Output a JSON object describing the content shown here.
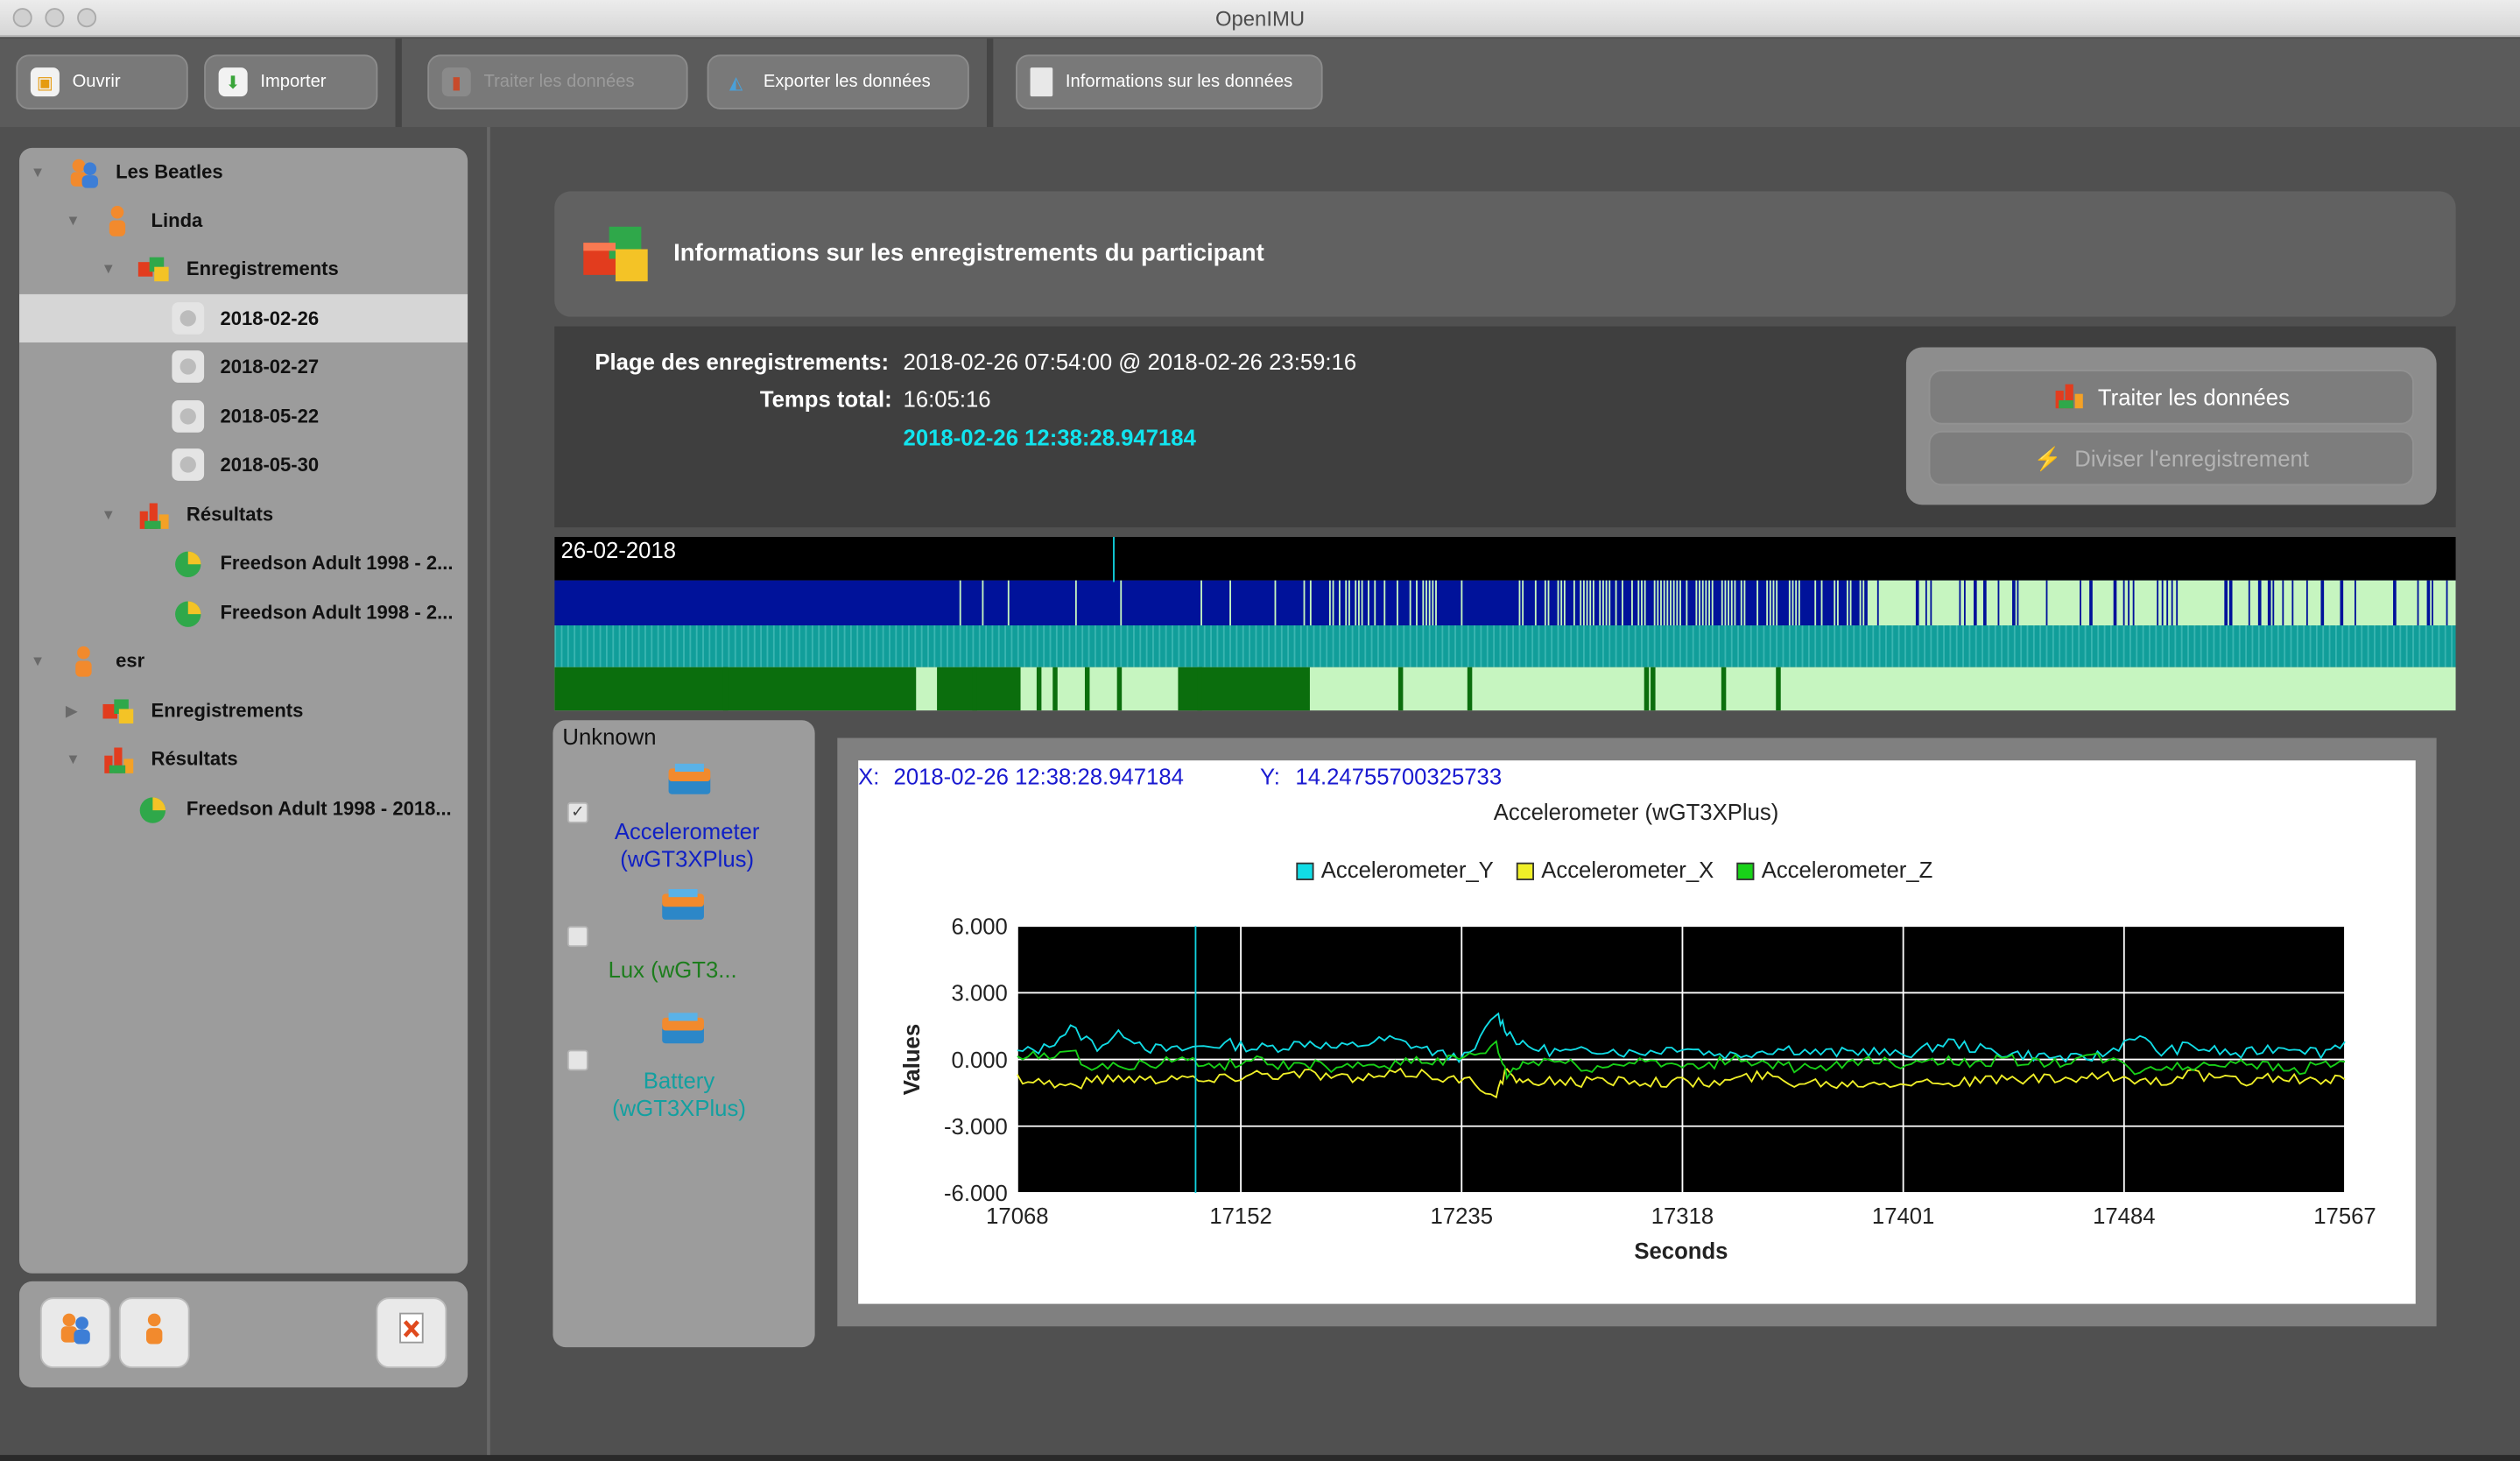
{
  "app": {
    "title": "OpenIMU"
  },
  "toolbar": {
    "open": "Ouvrir",
    "import": "Importer",
    "process": "Traiter les données",
    "export": "Exporter les données",
    "info": "Informations sur les données"
  },
  "tree": {
    "group": "Les Beatles",
    "p1": "Linda",
    "p1_records": "Enregistrements",
    "dates": [
      "2018-02-26",
      "2018-02-27",
      "2018-05-22",
      "2018-05-30"
    ],
    "p1_results": "Résultats",
    "p1_result_items": [
      "Freedson Adult 1998 - 2...",
      "Freedson Adult 1998 - 2..."
    ],
    "p2": "esr",
    "p2_records": "Enregistrements",
    "p2_results": "Résultats",
    "p2_result_items": [
      "Freedson Adult 1998 - 2018..."
    ]
  },
  "header": {
    "title": "Informations sur les enregistrements du participant"
  },
  "info": {
    "range_label": "Plage des enregistrements:",
    "range_value": "2018-02-26 07:54:00 @ 2018-02-26 23:59:16",
    "total_label": "Temps total:",
    "total_value": "16:05:16",
    "cursor_time": "2018-02-26 12:38:28.947184"
  },
  "actions": {
    "process": "Traiter les données",
    "split": "Diviser l'enregistrement"
  },
  "timeline": {
    "date": "26-02-2018",
    "colors": {
      "accel": "#00129a",
      "accel_gap": "#c6f5c0",
      "lux": "#119e9a",
      "battery": "#0b6e0d",
      "battery_gap": "#c6f5c0"
    }
  },
  "sensors": {
    "group": "Unknown",
    "items": [
      {
        "label": "Accelerometer (wGT3XPlus)",
        "checked": true,
        "color": "#1020c4"
      },
      {
        "label": "Lux (wGT3...",
        "checked": false,
        "color": "#1d7d1d"
      },
      {
        "label": "Battery (wGT3XPlus)",
        "checked": false,
        "color": "#13a0a0"
      }
    ]
  },
  "chart_header": {
    "x_label": "X:",
    "x_value": "2018-02-26 12:38:28.947184",
    "y_label": "Y:",
    "y_value": "14.24755700325733"
  },
  "chart_data": {
    "type": "line",
    "title": "Accelerometer (wGT3XPlus)",
    "xlabel": "Seconds",
    "ylabel": "Values",
    "xlim": [
      17068,
      17567
    ],
    "ylim": [
      -6,
      6
    ],
    "xticks": [
      "17068",
      "17152",
      "17235",
      "17318",
      "17401",
      "17484",
      "17567"
    ],
    "yticks": [
      "6.000",
      "3.000",
      "0.000",
      "-3.000",
      "-6.000"
    ],
    "grid": true,
    "legend_position": "top-center",
    "background": "#000000",
    "cursor_x": 17135,
    "series": [
      {
        "name": "Accelerometer_Y",
        "color": "#11dde6",
        "x": [
          17068,
          17078,
          17088,
          17098,
          17108,
          17118,
          17128,
          17138,
          17148,
          17158,
          17168,
          17178,
          17188,
          17198,
          17208,
          17218,
          17228,
          17238,
          17248,
          17252,
          17258,
          17268,
          17278,
          17288,
          17298,
          17308,
          17318,
          17328,
          17338,
          17348,
          17358,
          17368,
          17378,
          17388,
          17398,
          17408,
          17418,
          17428,
          17438,
          17448,
          17458,
          17468,
          17478,
          17488,
          17498,
          17508,
          17518,
          17528,
          17538,
          17548,
          17558,
          17567
        ],
        "values": [
          0.3,
          0.5,
          1.4,
          0.6,
          1.2,
          0.5,
          0.4,
          0.6,
          0.7,
          0.5,
          0.6,
          0.8,
          0.5,
          0.7,
          0.9,
          0.6,
          0.2,
          0.1,
          2.1,
          1.3,
          0.6,
          0.4,
          0.3,
          0.5,
          0.3,
          0.4,
          0.6,
          0.3,
          0.2,
          0.4,
          0.5,
          0.3,
          0.3,
          0.4,
          0.2,
          0.4,
          0.8,
          0.5,
          0.3,
          0.2,
          0.1,
          0.0,
          0.3,
          1.1,
          0.3,
          0.6,
          0.4,
          0.2,
          0.5,
          0.6,
          0.3,
          0.8
        ]
      },
      {
        "name": "Accelerometer_X",
        "color": "#f0f028",
        "x": [
          17068,
          17078,
          17088,
          17098,
          17108,
          17118,
          17128,
          17138,
          17148,
          17158,
          17168,
          17178,
          17188,
          17198,
          17208,
          17218,
          17228,
          17238,
          17248,
          17252,
          17258,
          17268,
          17278,
          17288,
          17298,
          17308,
          17318,
          17328,
          17338,
          17348,
          17358,
          17368,
          17378,
          17388,
          17398,
          17408,
          17418,
          17428,
          17438,
          17448,
          17458,
          17468,
          17478,
          17488,
          17498,
          17508,
          17518,
          17528,
          17538,
          17548,
          17558,
          17567
        ],
        "values": [
          -0.8,
          -1.0,
          -1.2,
          -0.9,
          -0.8,
          -0.9,
          -0.7,
          -1.0,
          -0.8,
          -0.6,
          -0.7,
          -0.6,
          -0.8,
          -0.9,
          -0.7,
          -0.6,
          -0.8,
          -1.0,
          -1.5,
          -0.5,
          -1.2,
          -0.9,
          -1.0,
          -1.0,
          -0.9,
          -1.0,
          -1.0,
          -1.1,
          -0.9,
          -0.7,
          -1.0,
          -1.0,
          -1.1,
          -1.0,
          -1.0,
          -1.0,
          -1.0,
          -1.0,
          -0.9,
          -0.9,
          -0.9,
          -0.9,
          -0.8,
          -0.9,
          -1.0,
          -0.6,
          -0.9,
          -1.0,
          -0.8,
          -0.9,
          -1.0,
          -0.9
        ]
      },
      {
        "name": "Accelerometer_Z",
        "color": "#18d218",
        "x": [
          17068,
          17078,
          17088,
          17098,
          17108,
          17118,
          17128,
          17138,
          17148,
          17158,
          17168,
          17178,
          17188,
          17198,
          17208,
          17218,
          17228,
          17238,
          17248,
          17252,
          17258,
          17268,
          17278,
          17288,
          17298,
          17308,
          17318,
          17328,
          17338,
          17348,
          17358,
          17368,
          17378,
          17388,
          17398,
          17408,
          17418,
          17428,
          17438,
          17448,
          17458,
          17468,
          17478,
          17488,
          17498,
          17508,
          17518,
          17528,
          17538,
          17548,
          17558,
          17567
        ],
        "values": [
          0.0,
          0.2,
          0.3,
          -0.4,
          -0.2,
          -0.3,
          0.1,
          -0.3,
          -0.2,
          -0.1,
          -0.3,
          -0.2,
          -0.5,
          -0.3,
          -0.2,
          0.0,
          -0.1,
          0.1,
          0.6,
          -0.7,
          -0.2,
          0.0,
          -0.3,
          -0.4,
          -0.1,
          0.0,
          -0.4,
          -0.3,
          0.1,
          -0.2,
          -0.3,
          -0.5,
          -0.3,
          0.1,
          -0.2,
          0.0,
          -0.1,
          -0.2,
          0.0,
          -0.1,
          -0.2,
          0.1,
          0.0,
          -0.5,
          -0.3,
          -0.4,
          -0.2,
          0.0,
          -0.3,
          -0.5,
          -0.2,
          -0.1
        ]
      }
    ]
  }
}
